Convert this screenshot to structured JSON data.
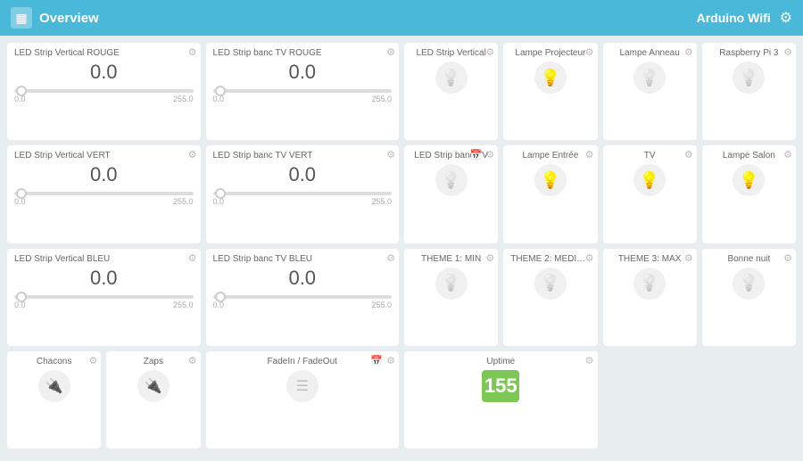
{
  "header": {
    "title": "Overview",
    "arduino_label": "Arduino Wifi",
    "logo_unicode": "▦"
  },
  "cards": {
    "row1": [
      {
        "id": "led-rouge",
        "title": "LED Strip Vertical ROUGE",
        "value": "0.0",
        "min": "0.0",
        "max": "255.0",
        "type": "slider"
      },
      {
        "id": "led-banc-rouge",
        "title": "LED Strip banc TV ROUGE",
        "value": "0.0",
        "min": "0.0",
        "max": "255.0",
        "type": "slider"
      },
      {
        "id": "led-strip-v",
        "title": "LED Strip Vertical",
        "type": "lamp",
        "state": "gray"
      },
      {
        "id": "lampe-proj",
        "title": "Lampe Projecteur",
        "type": "lamp",
        "state": "orange"
      },
      {
        "id": "lampe-anneau",
        "title": "Lampe Anneau",
        "type": "lamp",
        "state": "gray"
      },
      {
        "id": "raspi3",
        "title": "Raspberry Pi 3",
        "type": "lamp",
        "state": "gray"
      }
    ],
    "row2": [
      {
        "id": "led-vert",
        "title": "LED Strip Vertical VERT",
        "value": "0.0",
        "min": "0.0",
        "max": "255.0",
        "type": "slider"
      },
      {
        "id": "led-banc-vert",
        "title": "LED Strip banc TV VERT",
        "value": "0.0",
        "min": "0.0",
        "max": "255.0",
        "type": "slider"
      },
      {
        "id": "led-banc-tv",
        "title": "LED Strip banc TV",
        "type": "lamp",
        "state": "gray",
        "has_calendar": true
      },
      {
        "id": "lampe-entree",
        "title": "Lampe Entrée",
        "type": "lamp",
        "state": "orange"
      },
      {
        "id": "tv",
        "title": "TV",
        "type": "lamp",
        "state": "orange"
      },
      {
        "id": "lampe-salon",
        "title": "Lampe Salon",
        "type": "lamp",
        "state": "orange"
      }
    ],
    "row3": [
      {
        "id": "led-bleu",
        "title": "LED Strip Vertical BLEU",
        "value": "0.0",
        "min": "0.0",
        "max": "255.0",
        "type": "slider"
      },
      {
        "id": "led-banc-bleu",
        "title": "LED Strip banc TV BLEU",
        "value": "0.0",
        "min": "0.0",
        "max": "255.0",
        "type": "slider"
      },
      {
        "id": "theme1",
        "title": "THEME 1: MIN",
        "type": "lamp",
        "state": "gray"
      },
      {
        "id": "theme2",
        "title": "THEME 2: MEDIU...",
        "type": "lamp",
        "state": "gray"
      },
      {
        "id": "theme3",
        "title": "THEME 3: MAX",
        "type": "lamp",
        "state": "gray"
      },
      {
        "id": "bonne-nuit",
        "title": "Bonne nuit",
        "type": "lamp",
        "state": "gray"
      }
    ],
    "row4": [
      {
        "id": "chacons",
        "title": "Chacons",
        "type": "plug"
      },
      {
        "id": "zaps",
        "title": "Zaps",
        "type": "plug"
      },
      {
        "id": "fadein",
        "title": "FadeIn / FadeOut",
        "type": "fade"
      },
      {
        "id": "uptime",
        "title": "Uptime",
        "type": "uptime",
        "value": "155"
      }
    ]
  },
  "icons": {
    "gear": "⚙",
    "bulb": "💡",
    "plug": "🔌",
    "calendar": "📅",
    "bars": "≡"
  }
}
